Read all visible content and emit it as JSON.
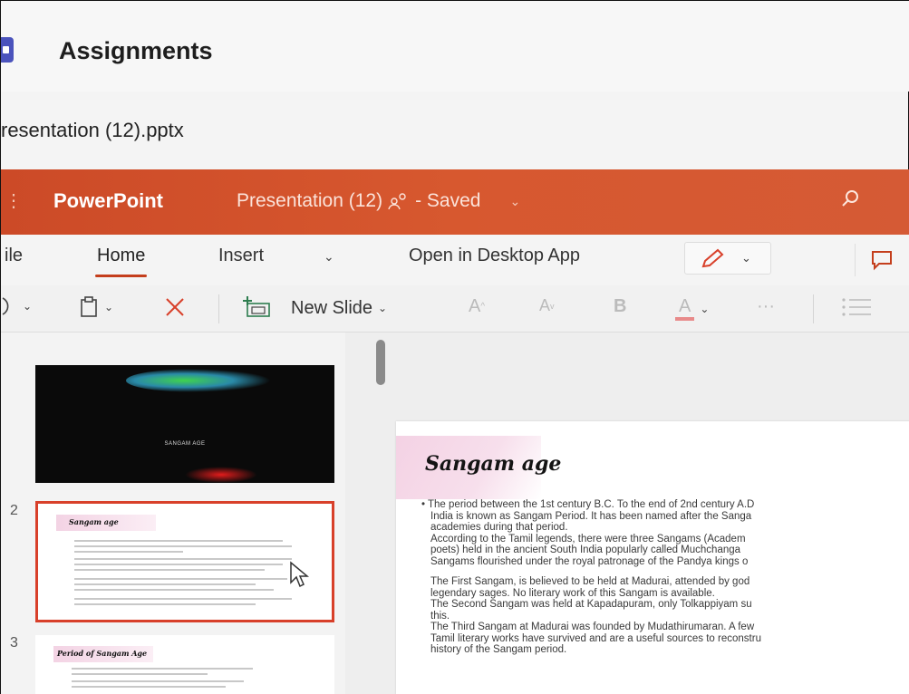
{
  "assignments": {
    "title": "Assignments",
    "file_name": "resentation (12).pptx"
  },
  "ppt_bar": {
    "app_name": "PowerPoint",
    "doc_title": "Presentation (12)",
    "status": "- Saved",
    "accent_color": "#d35230"
  },
  "tabs": {
    "file": "ile",
    "home": "Home",
    "insert": "Insert",
    "open_desktop": "Open in Desktop App"
  },
  "toolbar": {
    "new_slide": "New Slide",
    "grow_font": "A",
    "shrink_font": "A",
    "bold": "B",
    "font_color": "A",
    "more": "···"
  },
  "thumbnails": {
    "slide1_label": "SANGAM AGE",
    "slide2_number": "2",
    "slide2_title": "Sangam age",
    "slide3_number": "3",
    "slide3_title": "Period of Sangam Age"
  },
  "slide": {
    "title": "Sangam age",
    "lines": [
      "• The period between the 1st century B.C. To the end of 2nd century A.D",
      "India is known as Sangam Period. It has been named after the Sanga",
      "academies during that period.",
      "According to the Tamil legends, there were three Sangams (Academ",
      "poets) held in the ancient South India popularly called Muchchanga",
      "Sangams flourished under the royal patronage of the Pandya kings o",
      "The First Sangam, is believed to be held at Madurai, attended by god",
      "legendary sages. No literary work of this Sangam is available.",
      "The Second Sangam was held at Kapadapuram, only Tolkappiyam su",
      "this.",
      "The Third Sangam at Madurai was founded by Mudathirumaran. A few",
      "Tamil literary works have survived and are a useful sources to reconstru",
      "history of the Sangam period."
    ]
  }
}
